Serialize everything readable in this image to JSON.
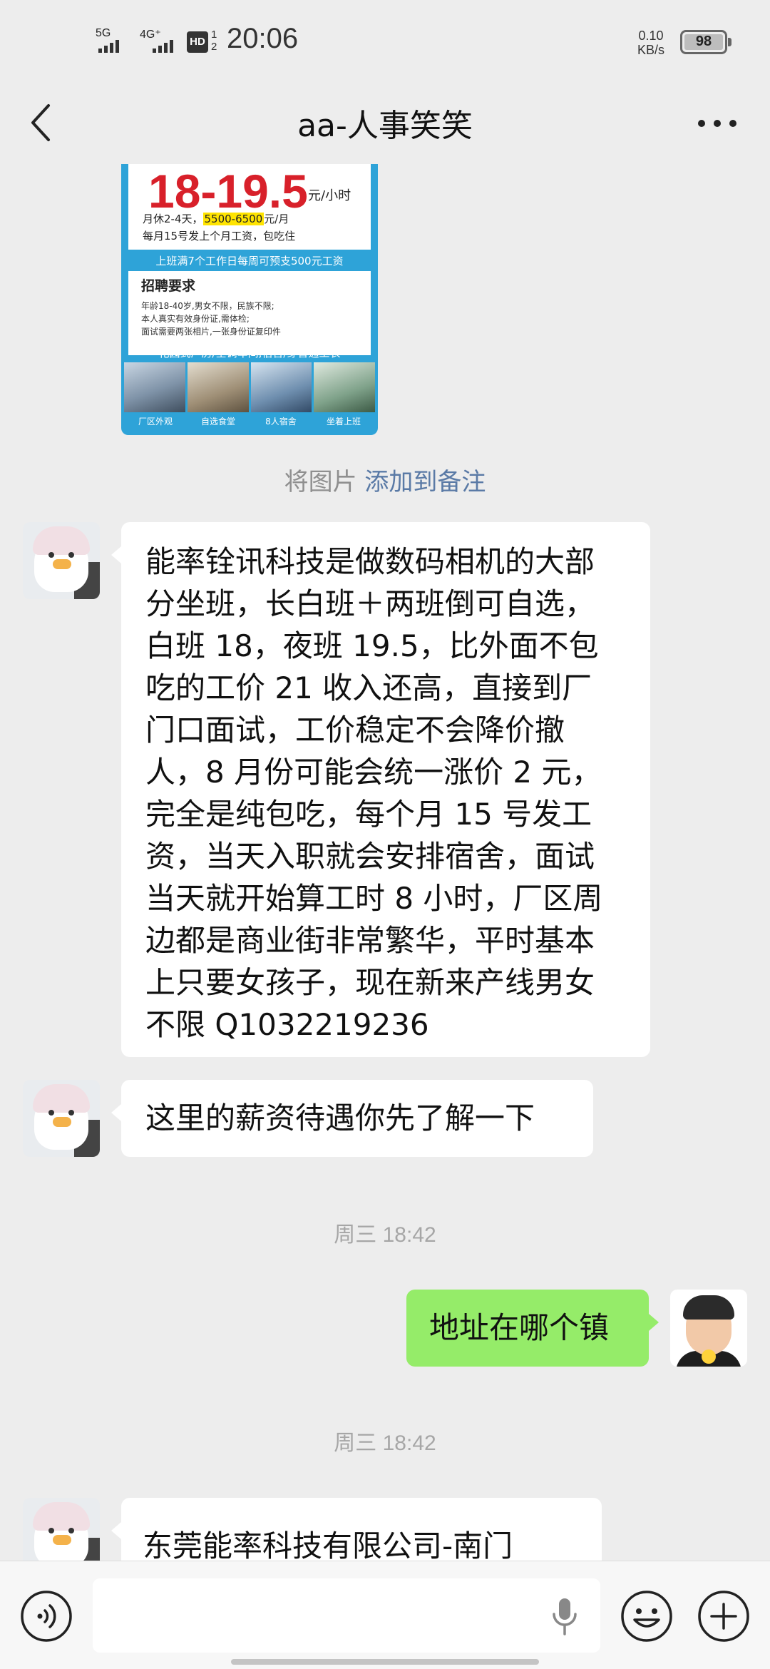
{
  "status_bar": {
    "signal_1": "5G",
    "signal_2": "4G⁺",
    "hd_label": "HD",
    "hd_slots": "1",
    "hd_slots_2": "2",
    "time": "20:06",
    "speed_value": "0.10",
    "speed_unit": "KB/s",
    "battery": "98"
  },
  "header": {
    "title": "aa-人事笑笑"
  },
  "image_message": {
    "price": "18-19.5",
    "price_unit": "元/小时",
    "line1_a": "月休2-4天，",
    "line1_salary": "5500-6500",
    "line1_b": "元/月",
    "line2": "每月15号发上个月工资，包吃住",
    "band": "上班满7个工作日每周可预支500元工资",
    "req_heading": "招聘要求",
    "req_1": "年龄18-40岁,男女不限，民族不限;",
    "req_2": "本人真实有效身份证,需体检;",
    "req_3": "面试需要两张相片,一张身份证复印件",
    "footer": "花园式厂房/空调车间,宿舍/穿普通工衣",
    "captions": [
      "厂区外观",
      "自选食堂",
      "8人宿舍",
      "坐着上班"
    ]
  },
  "system_note": {
    "prefix": "将图片",
    "link": "添加到备注"
  },
  "messages": [
    {
      "lines": [
        "能率铨讯科技是做数码相机的大部",
        "分坐班，长白班＋两班倒可自选，",
        "白班 18，夜班 19.5，比外面不包",
        "吃的工价 21 收入还高，直接到厂",
        "门口面试，工价稳定不会降价撤",
        "人，8 月份可能会统一涨价 2 元，",
        "完全是纯包吃，每个月 15 号发工",
        "资，当天入职就会安排宿舍，面试",
        "当天就开始算工时 8 小时，厂区周",
        "边都是商业街非常繁华，平时基本",
        "上只要女孩子，现在新来产线男女",
        "不限   Q1032219236"
      ]
    },
    {
      "text": "这里的薪资待遇你先了解一下"
    },
    {
      "time": "周三 18:42"
    },
    {
      "text": "地址在哪个镇"
    },
    {
      "time": "周三 18:42"
    },
    {
      "text": "东莞能率科技有限公司-南门"
    }
  ],
  "colors": {
    "background": "#ededed",
    "my_bubble": "#95ec69",
    "their_bubble": "#ffffff",
    "link": "#5a7aa6"
  },
  "icons": {
    "back": "chevron-left-icon",
    "more": "more-dots-icon",
    "voice": "voice-icon",
    "mic": "mic-icon",
    "emoji": "emoji-icon",
    "plus": "plus-icon"
  }
}
